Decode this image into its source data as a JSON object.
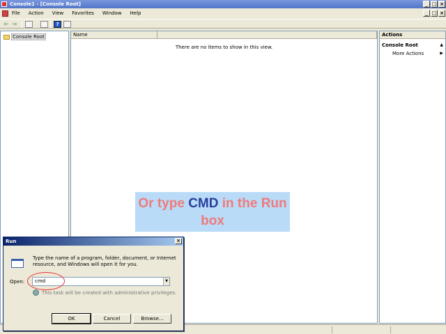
{
  "window": {
    "title": "Console1 - [Console Root]",
    "min_glyph": "_",
    "max_glyph": "□",
    "close_glyph": "×"
  },
  "menubar": {
    "items": [
      "File",
      "Action",
      "View",
      "Favorites",
      "Window",
      "Help"
    ]
  },
  "toolbar": {
    "back_glyph": "⇦",
    "forward_glyph": "⇨",
    "help_glyph": "?"
  },
  "tree": {
    "root_label": "Console Root"
  },
  "list": {
    "column_name": "Name",
    "empty_message": "There are no items to show in this view."
  },
  "actions": {
    "header": "Actions",
    "section": "Console Root",
    "section_arrow": "▲",
    "items": [
      {
        "label": "More Actions",
        "arrow": "▶"
      }
    ]
  },
  "caption": {
    "part1": "Or type ",
    "highlight": "CMD",
    "part2": " in the Run box"
  },
  "run_dialog": {
    "title": "Run",
    "close_glyph": "×",
    "description": "Type the name of a program, folder, document, or Internet resource, and Windows will open it for you.",
    "open_label": "Open:",
    "open_value": "cmd",
    "dropdown_glyph": "▼",
    "admin_note": "This task will be created with administrative privileges.",
    "ok_label": "OK",
    "cancel_label": "Cancel",
    "browse_label": "Browse..."
  },
  "colors": {
    "title_active": "#5177c8",
    "caption_bg": "#b9dbf8",
    "caption_text": "#f07a7a",
    "caption_highlight": "#2b3f9a",
    "highlight_circle": "#e83030"
  }
}
